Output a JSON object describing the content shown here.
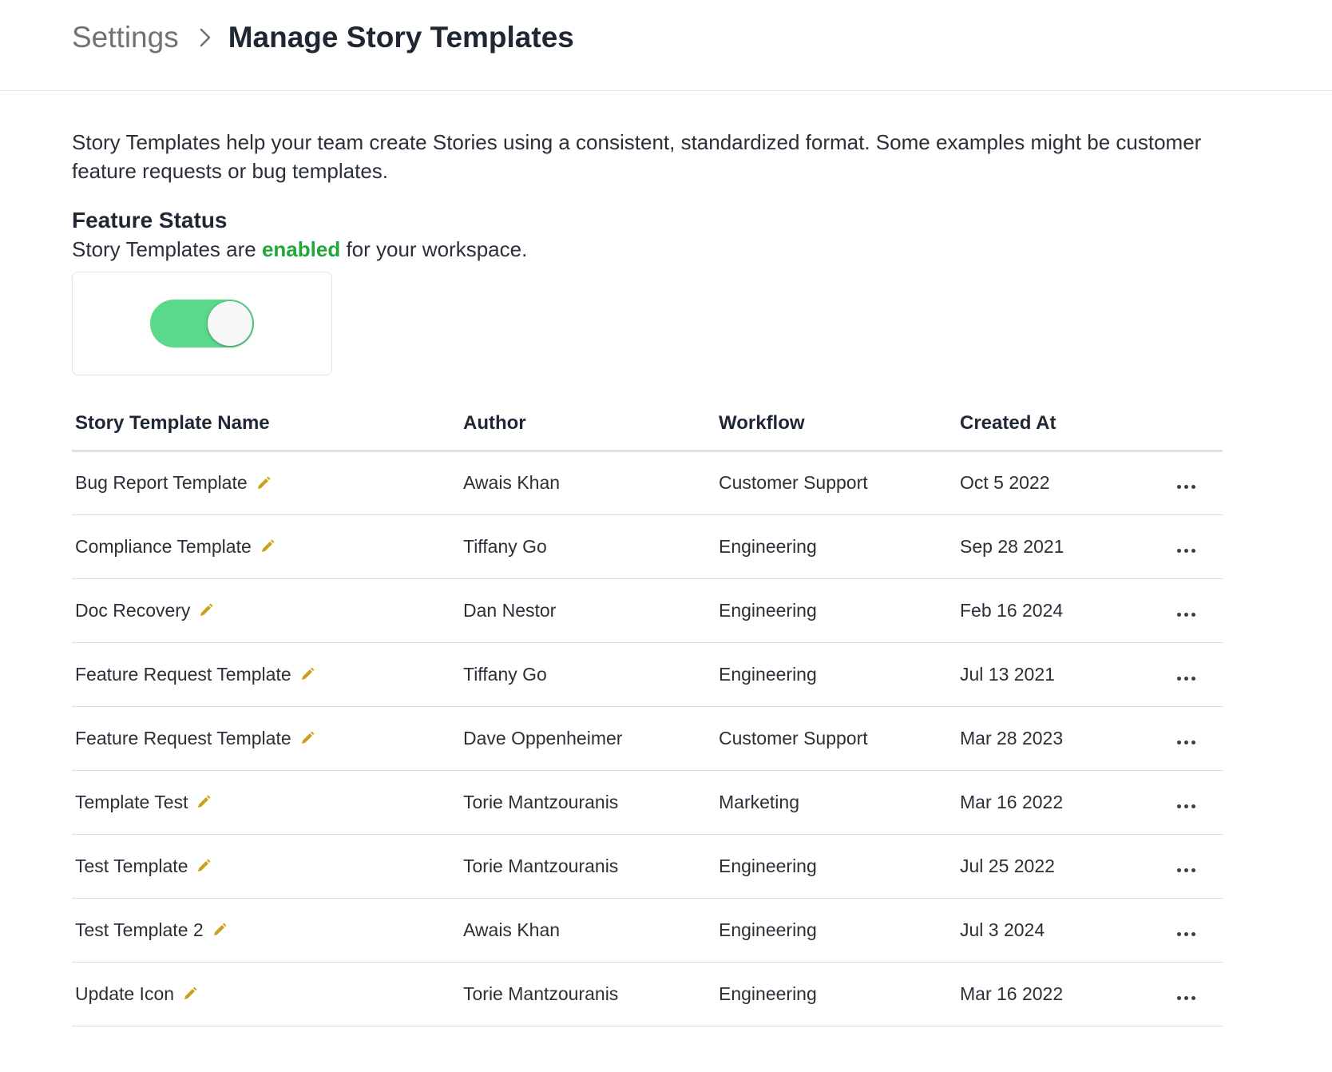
{
  "breadcrumb": {
    "root": "Settings",
    "current": "Manage Story Templates"
  },
  "intro": "Story Templates help your team create Stories using a consistent, standardized format. Some examples might be customer feature requests or bug templates.",
  "feature": {
    "title": "Feature Status",
    "status_prefix": "Story Templates are ",
    "status_word": "enabled",
    "status_suffix": " for your workspace.",
    "toggle_on": true,
    "status_color": "#22a83a",
    "toggle_color": "#5bd98a"
  },
  "table": {
    "headers": {
      "name": "Story Template Name",
      "author": "Author",
      "workflow": "Workflow",
      "created": "Created At"
    },
    "rows": [
      {
        "name": "Bug Report Template",
        "author": "Awais Khan",
        "workflow": "Customer Support",
        "created": "Oct 5 2022"
      },
      {
        "name": "Compliance Template",
        "author": "Tiffany Go",
        "workflow": "Engineering",
        "created": "Sep 28 2021"
      },
      {
        "name": "Doc Recovery",
        "author": "Dan Nestor",
        "workflow": "Engineering",
        "created": "Feb 16 2024"
      },
      {
        "name": "Feature Request Template",
        "author": "Tiffany Go",
        "workflow": "Engineering",
        "created": "Jul 13 2021"
      },
      {
        "name": "Feature Request Template",
        "author": "Dave Oppenheimer",
        "workflow": "Customer Support",
        "created": "Mar 28 2023"
      },
      {
        "name": "Template Test",
        "author": "Torie Mantzouranis",
        "workflow": "Marketing",
        "created": "Mar 16 2022"
      },
      {
        "name": "Test Template",
        "author": "Torie Mantzouranis",
        "workflow": "Engineering",
        "created": "Jul 25 2022"
      },
      {
        "name": "Test Template 2",
        "author": "Awais Khan",
        "workflow": "Engineering",
        "created": "Jul 3 2024"
      },
      {
        "name": "Update Icon",
        "author": "Torie Mantzouranis",
        "workflow": "Engineering",
        "created": "Mar 16 2022"
      }
    ]
  },
  "icons": {
    "breadcrumb_separator": "chevron-right-icon",
    "edit": "pencil-icon",
    "row_actions": "more-horizontal-icon",
    "edit_color": "#c9a21a"
  }
}
